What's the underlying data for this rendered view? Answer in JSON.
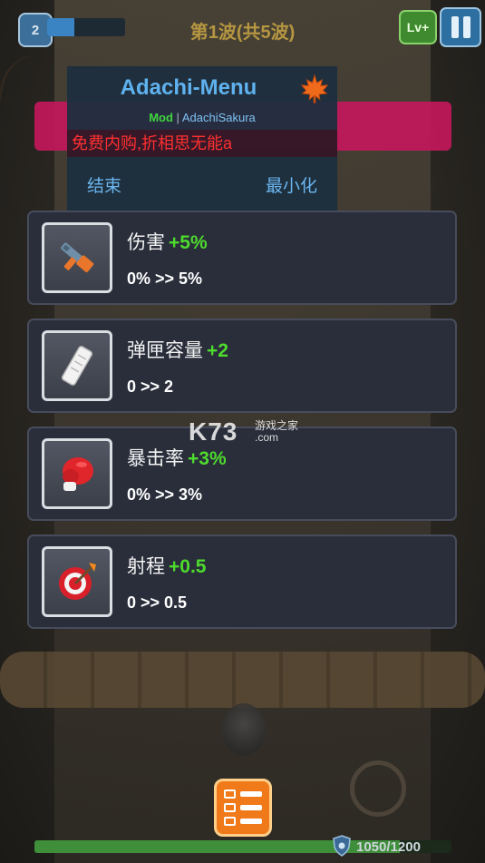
{
  "hud": {
    "player_level": "2",
    "xp_progress": 0.35,
    "wave_text": "第1波(共5波)",
    "lv_button_label": "Lv+",
    "pause_icon": "pause-icon"
  },
  "mod_menu": {
    "title": "Adachi-Menu",
    "icon": "maple-leaf-icon",
    "mod_label": "Mod",
    "separator": "|",
    "author": "AdachiSakura",
    "warning": "免费内购,折相思无能a",
    "end_label": "结束",
    "minimize_label": "最小化"
  },
  "upgrades": [
    {
      "icon": "gun-icon",
      "name": "伤害",
      "bonus": "+5%",
      "change": "0% >> 5%"
    },
    {
      "icon": "magazine-icon",
      "name": "弹匣容量",
      "bonus": "+2",
      "change": "0 >> 2"
    },
    {
      "icon": "boxing-glove-icon",
      "name": "暴击率",
      "bonus": "+3%",
      "change": "0% >> 3%"
    },
    {
      "icon": "target-icon",
      "name": "射程",
      "bonus": "+0.5",
      "change": "0 >> 0.5"
    }
  ],
  "watermark": {
    "logo": "K73",
    "site": "游戏之家",
    "domain": ".com"
  },
  "bottom": {
    "menu_icon": "list-menu-icon",
    "hp_current": 1050,
    "hp_max": 1200,
    "hp_text": "1050/1200"
  },
  "colors": {
    "accent_blue": "#5fb2ef",
    "bonus_green": "#4ddb2d",
    "warning_red": "#ff3030",
    "ribbon_pink": "#c2185b",
    "menu_orange": "#f07a1a"
  }
}
